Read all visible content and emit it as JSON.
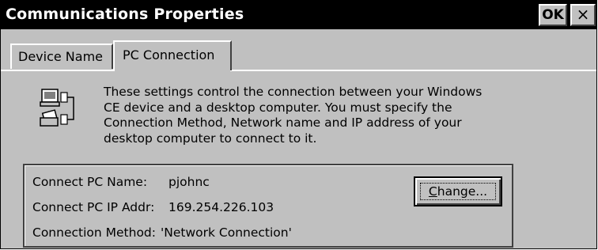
{
  "window": {
    "title": "Communications Properties",
    "ok_label": "OK",
    "close_label": "×"
  },
  "tabs": [
    {
      "label": "Device Name",
      "selected": false
    },
    {
      "label": "PC Connection",
      "selected": true
    }
  ],
  "description": "These settings control the connection between your Windows CE device and a desktop computer.  You must specify the Connection Method, Network name and IP address of your desktop computer to connect to it.",
  "description_lines": [
    "These settings control the connection between your Windows",
    "CE device and a desktop computer.  You must specify the",
    "Connection Method, Network name and IP address of your",
    "desktop computer to connect to it."
  ],
  "icon": "pc-connection-icon",
  "connection": {
    "pc_name_label": "Connect PC Name:",
    "pc_name_value": "pjohnc",
    "ip_label": "Connect PC IP Addr:",
    "ip_value": "169.254.226.103",
    "method_label": "Connection Method:",
    "method_value": "'Network Connection'"
  },
  "change_button": {
    "mnemonic": "C",
    "rest": "hange..."
  },
  "colors": {
    "titlebar": "#000000",
    "face": "#c0c0c0"
  }
}
